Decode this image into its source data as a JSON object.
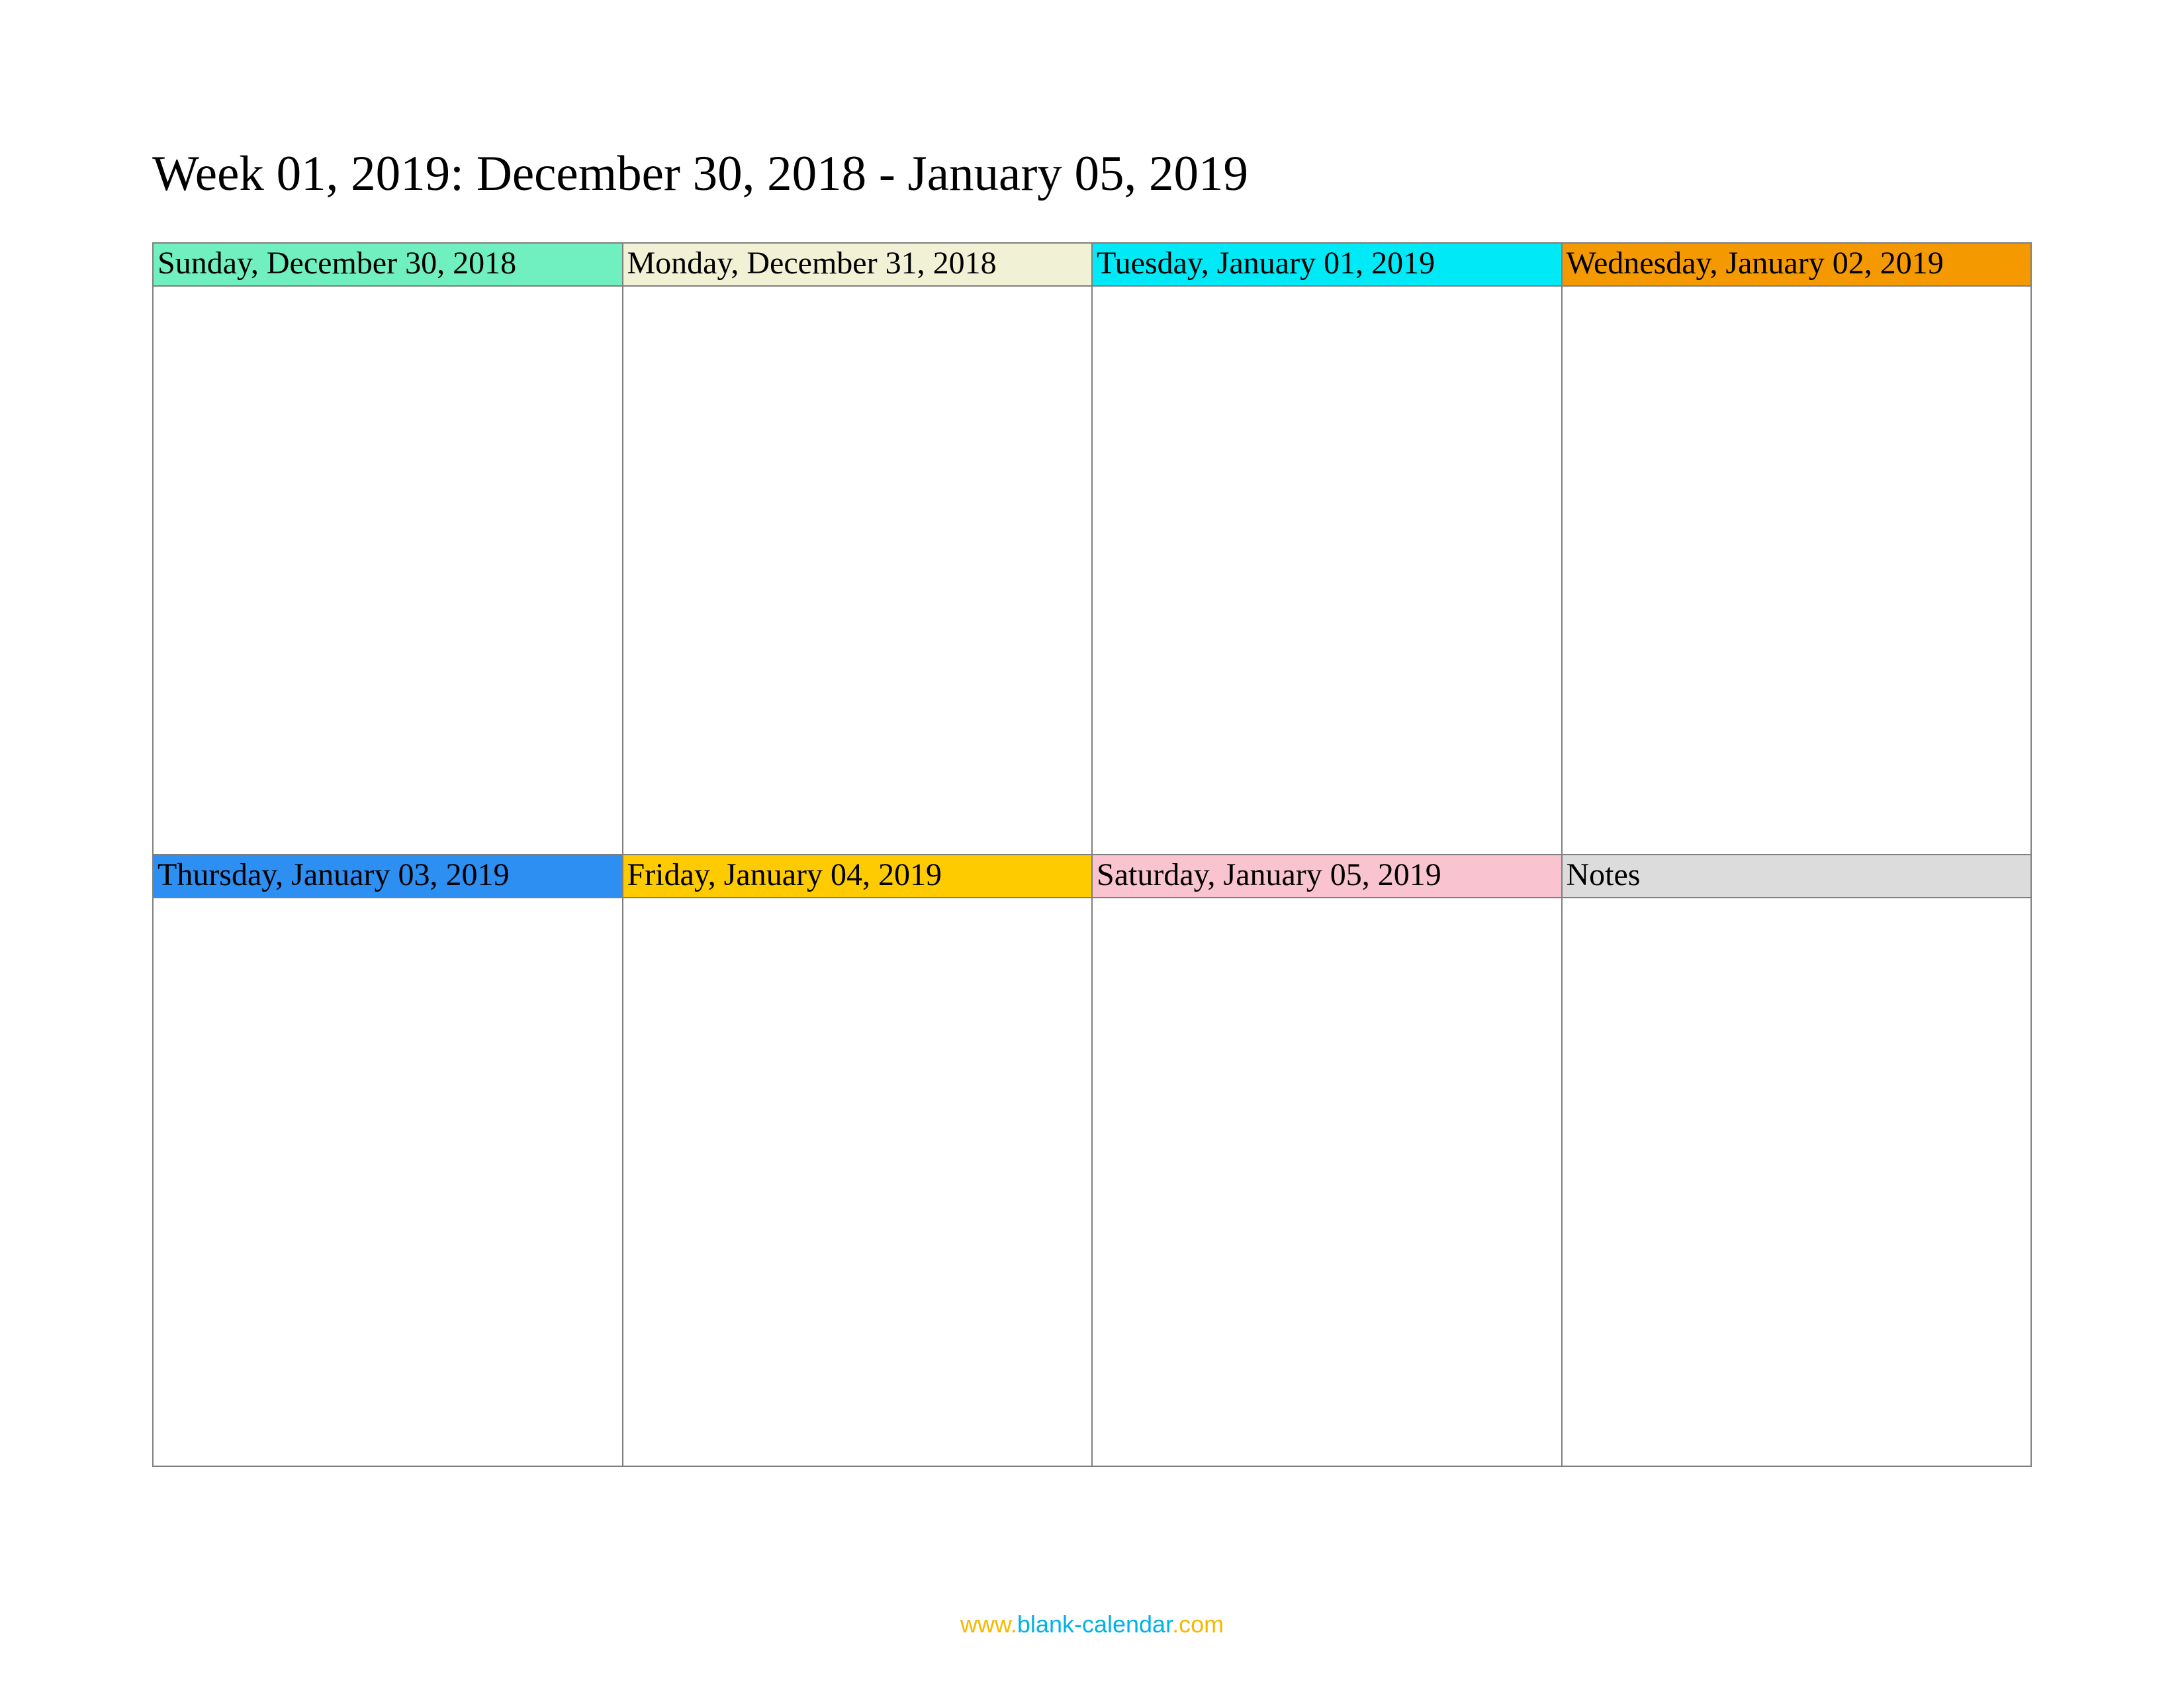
{
  "title": "Week 01, 2019: December 30, 2018 - January 05, 2019",
  "cells": [
    {
      "label": "Sunday, December 30, 2018",
      "color": "#70efc1"
    },
    {
      "label": "Monday, December 31, 2018",
      "color": "#f1f1d5"
    },
    {
      "label": "Tuesday, January 01, 2019",
      "color": "#00e9f7"
    },
    {
      "label": "Wednesday, January 02, 2019",
      "color": "#f49a00"
    },
    {
      "label": "Thursday, January 03, 2019",
      "color": "#2d8ff2"
    },
    {
      "label": "Friday, January 04, 2019",
      "color": "#fdcb00"
    },
    {
      "label": "Saturday, January 05, 2019",
      "color": "#f9c3cf"
    },
    {
      "label": "Notes",
      "color": "#dcdcdc"
    }
  ],
  "footer": {
    "p1": "www.",
    "p2": "blank-calendar",
    "p3": ".com"
  }
}
